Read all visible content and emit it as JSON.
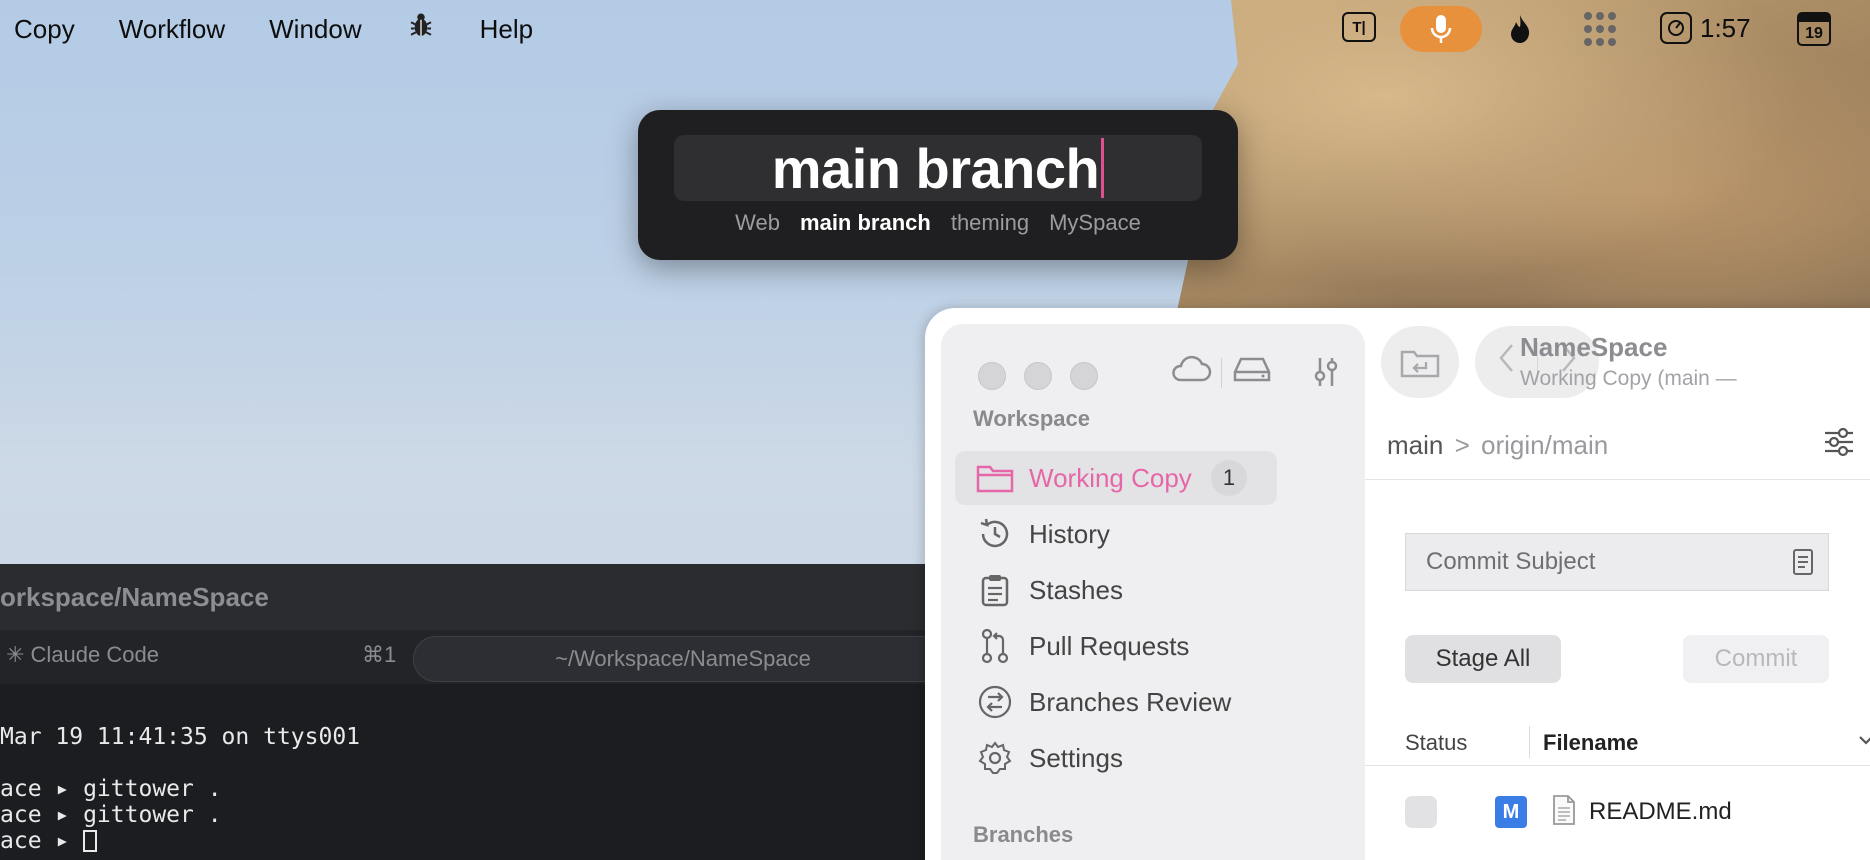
{
  "menubar": {
    "items": [
      "Copy",
      "Workflow",
      "Window",
      "Help"
    ],
    "bug_icon": "bug-icon",
    "status": {
      "tb_label": "T|",
      "clock": "1:57",
      "calendar_day": "19"
    }
  },
  "spotlight": {
    "query": "main branch",
    "tags": [
      "Web",
      "main branch",
      "theming",
      "MySpace"
    ]
  },
  "terminal": {
    "title": "orkspace/NameSpace",
    "tab1": "✳ Claude Code",
    "tab1_shortcut": "⌘1",
    "tab2": "~/Workspace/NameSpace",
    "lines": [
      "Mar 19 11:41:35 on ttys001",
      "",
      "ace ▸ gittower .",
      "ace ▸ gittower .",
      "ace ▸ "
    ]
  },
  "tower": {
    "title": "NameSpace",
    "subtitle": "Working Copy (main —",
    "sidebar": {
      "workspace_label": "Workspace",
      "items": [
        {
          "label": "Working Copy",
          "badge": "1"
        },
        {
          "label": "History"
        },
        {
          "label": "Stashes"
        },
        {
          "label": "Pull Requests"
        },
        {
          "label": "Branches Review"
        },
        {
          "label": "Settings"
        }
      ],
      "branches_label": "Branches"
    },
    "branch": {
      "local": "main",
      "separator": ">",
      "remote": "origin/main"
    },
    "commit_subject_placeholder": "Commit Subject",
    "stage_all": "Stage All",
    "commit": "Commit",
    "table": {
      "columns": [
        "Status",
        "Filename"
      ],
      "rows": [
        {
          "status": "M",
          "filename": "README.md"
        }
      ]
    }
  }
}
